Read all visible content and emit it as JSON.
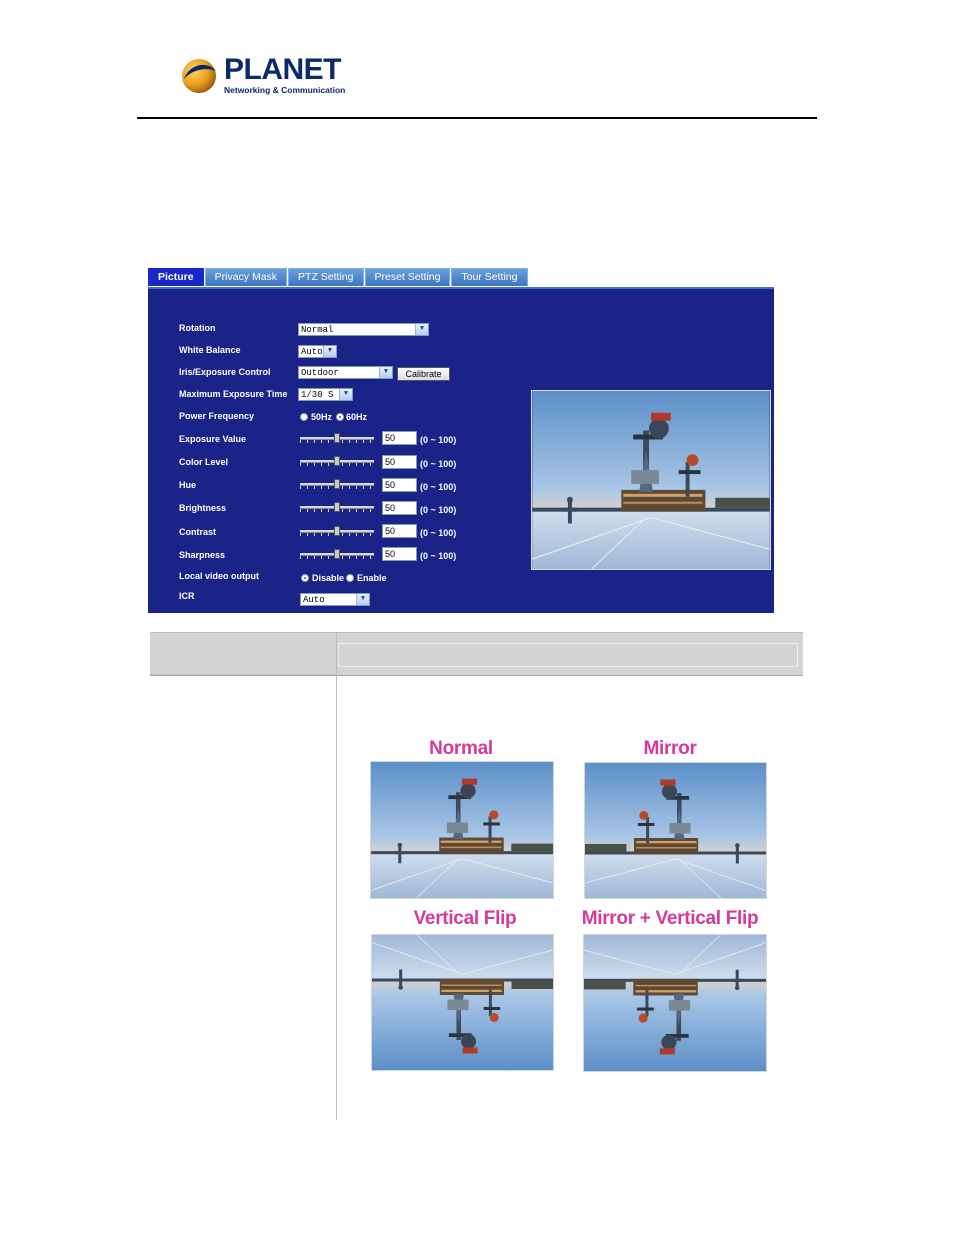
{
  "header": {
    "brand": "PLANET",
    "tagline": "Networking & Communication"
  },
  "tabs": [
    {
      "label": "Picture",
      "active": true
    },
    {
      "label": "Privacy Mask",
      "active": false
    },
    {
      "label": "PTZ Setting",
      "active": false
    },
    {
      "label": "Preset Setting",
      "active": false
    },
    {
      "label": "Tour Setting",
      "active": false
    }
  ],
  "settings": {
    "rotation": {
      "label": "Rotation",
      "value": "Normal"
    },
    "white_balance": {
      "label": "White Balance",
      "value": "Auto"
    },
    "iris": {
      "label": "Iris/Exposure Control",
      "value": "Outdoor",
      "button": "Calibrate"
    },
    "max_exposure": {
      "label": "Maximum Exposure Time",
      "value": "1/30 S"
    },
    "power_frequency": {
      "label": "Power Frequency",
      "option1": "50Hz",
      "option2": "60Hz",
      "selected": "60Hz"
    },
    "sliders": [
      {
        "label": "Exposure Value",
        "value": "50",
        "range": "(0 ~ 100)",
        "level": 0.5
      },
      {
        "label": "Color Level",
        "value": "50",
        "range": "(0 ~ 100)",
        "level": 0.5
      },
      {
        "label": "Hue",
        "value": "50",
        "range": "(0 ~ 100)",
        "level": 0.5
      },
      {
        "label": "Brightness",
        "value": "50",
        "range": "(0 ~ 100)",
        "level": 0.5
      },
      {
        "label": "Contrast",
        "value": "50",
        "range": "(0 ~ 100)",
        "level": 0.5
      },
      {
        "label": "Sharpness",
        "value": "50",
        "range": "(0 ~ 100)",
        "level": 0.5
      }
    ],
    "local_video": {
      "label": "Local video output",
      "option1": "Disable",
      "option2": "Enable",
      "selected": "Disable"
    },
    "icr": {
      "label": "ICR",
      "value": "Auto"
    }
  },
  "examples": {
    "normal": "Normal",
    "mirror": "Mirror",
    "vertical_flip": "Vertical Flip",
    "mirror_vertical_flip": "Mirror + Vertical Flip"
  },
  "colors": {
    "panel_bg": "#1a2488",
    "active_tab": "#1a28c8",
    "caption": "#d6399a",
    "brand": "#0b2a6b"
  }
}
